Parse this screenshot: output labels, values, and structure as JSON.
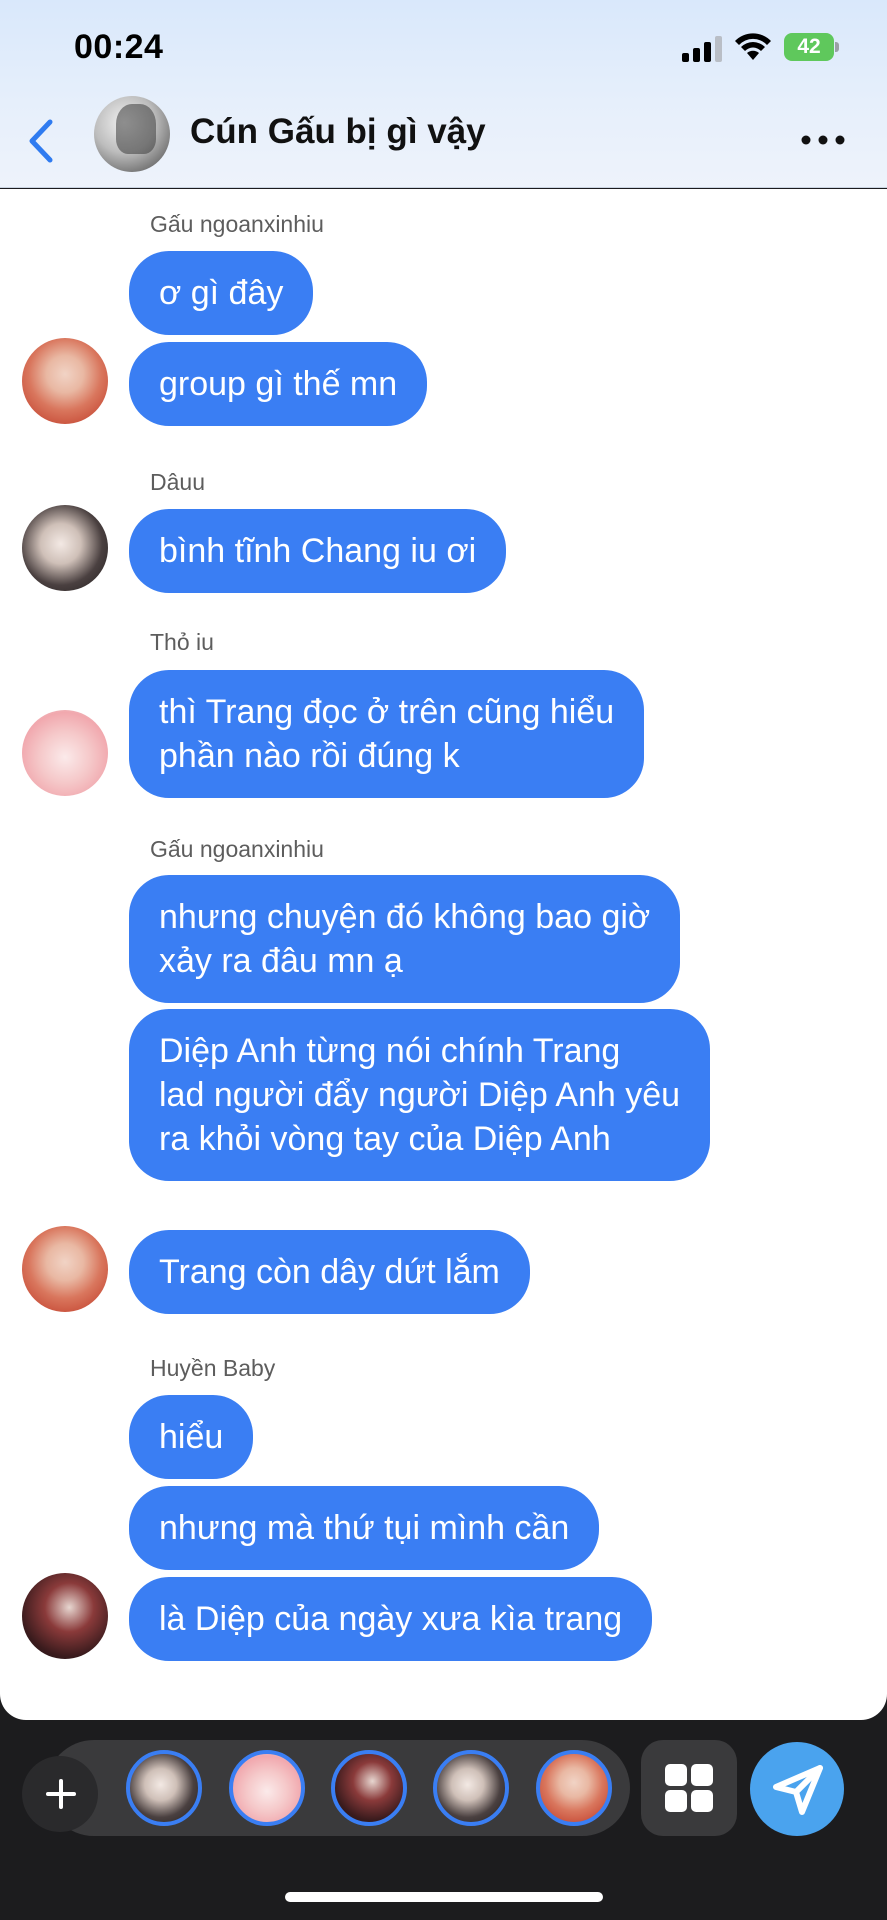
{
  "status_bar": {
    "time": "00:24",
    "battery": "42"
  },
  "header": {
    "title": "Cún Gấu bị gì vậy",
    "back_icon": "chevron-left-icon",
    "more_icon": "more-horizontal-icon"
  },
  "messages": {
    "s1": "Gấu ngoanxinhiu",
    "m1": "ơ gì đây",
    "m2": "group gì thế mn",
    "s2": "Dâuu",
    "m3": "bình tĩnh Chang iu ơi",
    "s3": "Thỏ iu",
    "m4_line1": "thì Trang đọc ở trên cũng hiểu",
    "m4_line2": "phần nào rồi đúng k",
    "s4": "Gấu ngoanxinhiu",
    "m5_line1": "nhưng chuyện đó không bao giờ",
    "m5_line2": "xảy ra đâu mn ạ",
    "m6_line1": "Diệp Anh từng nói chính Trang",
    "m6_line2": "lad người đẩy người Diệp Anh yêu",
    "m6_line3": "ra khỏi vòng tay của Diệp Anh",
    "m7": "Trang còn dây dứt lắm",
    "s5": "Huyền Baby",
    "m8": "hiểu",
    "m9": "nhưng mà thứ tụi mình cần",
    "m10": "là Diệp của ngày xưa kìa trang"
  },
  "theme": {
    "bubble_color": "#3a7ef3",
    "send_color": "#4aa3ee",
    "accent": "#2f7bf0"
  },
  "bottom_bar": {
    "plus_icon": "plus-icon",
    "grid_icon": "grid-icon",
    "send_icon": "send-icon"
  }
}
